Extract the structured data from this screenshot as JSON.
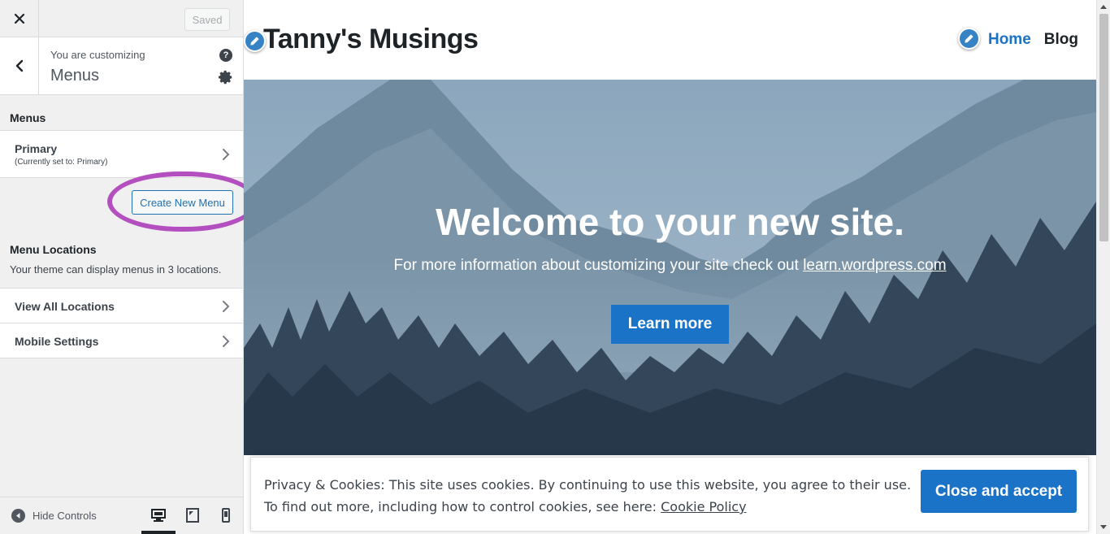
{
  "sidebar": {
    "saved_label": "Saved",
    "customizing_label": "You are customizing",
    "customizing_title": "Menus",
    "menus_section_title": "Menus",
    "menu_items": [
      {
        "label": "Primary",
        "sublabel": "(Currently set to: Primary)"
      }
    ],
    "create_new_menu_label": "Create New Menu",
    "locations_title": "Menu Locations",
    "locations_desc": "Your theme can display menus in 3 locations.",
    "location_rows": [
      {
        "label": "View All Locations"
      },
      {
        "label": "Mobile Settings"
      }
    ],
    "hide_controls_label": "Hide Controls",
    "devices": [
      "desktop-icon",
      "tablet-icon",
      "mobile-icon"
    ],
    "active_device": "desktop"
  },
  "preview": {
    "site_title": "Tanny's Musings",
    "nav": [
      {
        "label": "Home",
        "active": true
      },
      {
        "label": "Blog",
        "active": false
      }
    ],
    "hero_title": "Welcome to your new site.",
    "hero_sub_prefix": "For more information about customizing your site check out ",
    "hero_sub_link": "learn.wordpress.com",
    "learn_more_label": "Learn more",
    "cookie_line1": "Privacy & Cookies: This site uses cookies. By continuing to use this website, you agree to their use.",
    "cookie_line2_prefix": "To find out more, including how to control cookies, see here: ",
    "cookie_link": "Cookie Policy",
    "accept_label": "Close and accept"
  },
  "colors": {
    "accent": "#1a73c6",
    "highlight": "#b44fc0",
    "sidebar_bg": "#f0f0f1"
  }
}
